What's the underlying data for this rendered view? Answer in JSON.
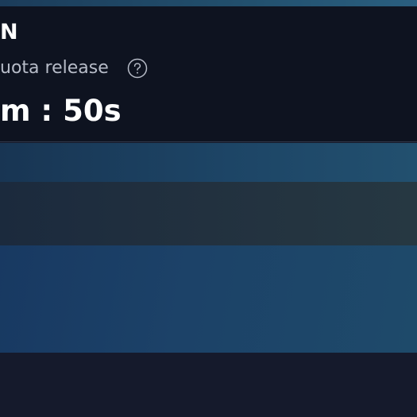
{
  "quota_panel": {
    "title": "N",
    "subtitle": "uota release",
    "help_icon": "question-circle-icon",
    "countdown": "m : 50s"
  },
  "colors": {
    "panel_background": "#0e1320",
    "page_background": "#14192a",
    "band_top": "#1d4566",
    "band_middle": "#22313f",
    "band_lower": "#1c4268",
    "text_primary": "#ffffff",
    "text_secondary": "#b7bcc8"
  }
}
